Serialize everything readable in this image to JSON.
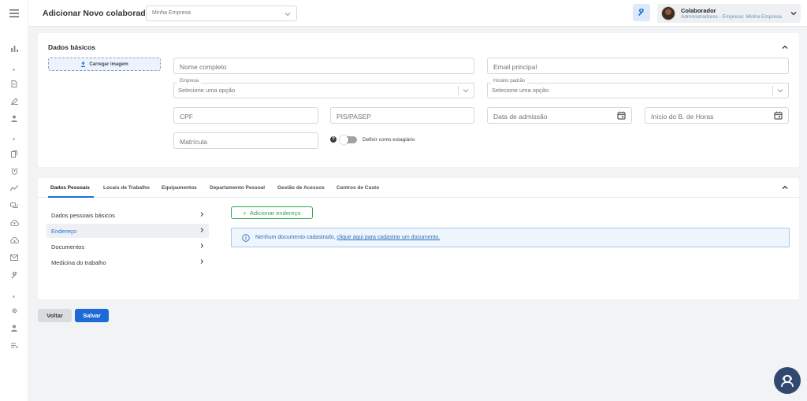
{
  "sidebar": {
    "icons": [
      "menu-icon",
      "bar-chart-icon",
      "document-icon",
      "pen-icon",
      "user-icon",
      "files-icon",
      "alarm-icon",
      "trend-icon",
      "chat-icon",
      "cloud-up-icon",
      "cloud-down-icon",
      "mail-icon",
      "wrench-icon",
      "gear-icon",
      "person-icon",
      "list-icon"
    ]
  },
  "header": {
    "title": "Adicionar Novo colaborador",
    "company_select": "Minha Empresa",
    "user": {
      "name": "Colaborador",
      "role": "Administradores - Empresa: Minha Empresa"
    }
  },
  "basic": {
    "title": "Dados básicos",
    "upload_label": "Carregar imagem",
    "fields": {
      "full_name": "Nome completo",
      "email": "Email principal",
      "company_legend": "Empresa",
      "company_value": "Selecione uma opção",
      "schedule_legend": "Horário padrão",
      "schedule_value": "Selecione uma opção",
      "cpf": "CPF",
      "pis": "PIS/PASEP",
      "admission_date": "Data de admissão",
      "hours_bank_start": "Início do B. de Horas",
      "registration": "Matrícula"
    },
    "intern_toggle_label": "Definir como estagiário",
    "intern_toggle_on": false
  },
  "tabs": [
    "Dados Pessoais",
    "Locais de Trabalho",
    "Equipamentos",
    "Departamento Pessoal",
    "Gestão de Acessos",
    "Centros de Custo"
  ],
  "active_tab": "Dados Pessoais",
  "subnav": [
    "Dados pessoais básicos",
    "Endereço",
    "Documentos",
    "Medicina do trabalho"
  ],
  "active_subnav": "Endereço",
  "address": {
    "add_button": "Adicionar endereço",
    "info_text": "Nenhum documento cadastrado,",
    "info_link": "clique aqui para cadastrar um documento."
  },
  "footer": {
    "back": "Voltar",
    "save": "Salvar"
  },
  "colors": {
    "primary": "#1b6ad6",
    "success": "#2fa84f",
    "info_bg": "#eef5fd"
  }
}
